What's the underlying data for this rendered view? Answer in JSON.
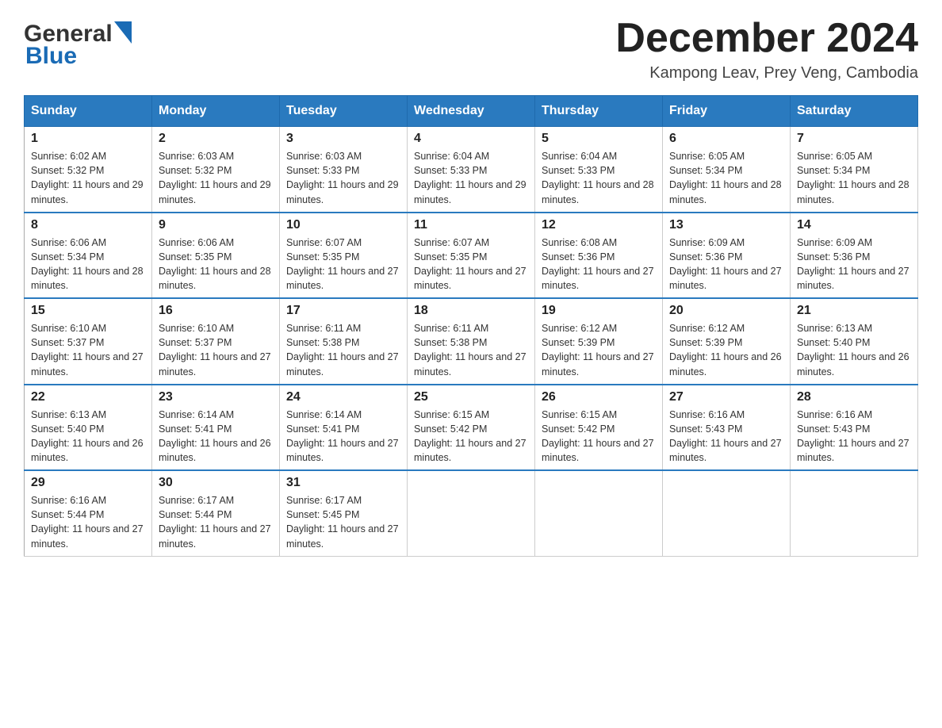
{
  "header": {
    "logo_general": "General",
    "logo_blue": "Blue",
    "month_title": "December 2024",
    "location": "Kampong Leav, Prey Veng, Cambodia"
  },
  "days_of_week": [
    "Sunday",
    "Monday",
    "Tuesday",
    "Wednesday",
    "Thursday",
    "Friday",
    "Saturday"
  ],
  "weeks": [
    [
      {
        "day": "1",
        "sunrise": "6:02 AM",
        "sunset": "5:32 PM",
        "daylight": "11 hours and 29 minutes."
      },
      {
        "day": "2",
        "sunrise": "6:03 AM",
        "sunset": "5:32 PM",
        "daylight": "11 hours and 29 minutes."
      },
      {
        "day": "3",
        "sunrise": "6:03 AM",
        "sunset": "5:33 PM",
        "daylight": "11 hours and 29 minutes."
      },
      {
        "day": "4",
        "sunrise": "6:04 AM",
        "sunset": "5:33 PM",
        "daylight": "11 hours and 29 minutes."
      },
      {
        "day": "5",
        "sunrise": "6:04 AM",
        "sunset": "5:33 PM",
        "daylight": "11 hours and 28 minutes."
      },
      {
        "day": "6",
        "sunrise": "6:05 AM",
        "sunset": "5:34 PM",
        "daylight": "11 hours and 28 minutes."
      },
      {
        "day": "7",
        "sunrise": "6:05 AM",
        "sunset": "5:34 PM",
        "daylight": "11 hours and 28 minutes."
      }
    ],
    [
      {
        "day": "8",
        "sunrise": "6:06 AM",
        "sunset": "5:34 PM",
        "daylight": "11 hours and 28 minutes."
      },
      {
        "day": "9",
        "sunrise": "6:06 AM",
        "sunset": "5:35 PM",
        "daylight": "11 hours and 28 minutes."
      },
      {
        "day": "10",
        "sunrise": "6:07 AM",
        "sunset": "5:35 PM",
        "daylight": "11 hours and 27 minutes."
      },
      {
        "day": "11",
        "sunrise": "6:07 AM",
        "sunset": "5:35 PM",
        "daylight": "11 hours and 27 minutes."
      },
      {
        "day": "12",
        "sunrise": "6:08 AM",
        "sunset": "5:36 PM",
        "daylight": "11 hours and 27 minutes."
      },
      {
        "day": "13",
        "sunrise": "6:09 AM",
        "sunset": "5:36 PM",
        "daylight": "11 hours and 27 minutes."
      },
      {
        "day": "14",
        "sunrise": "6:09 AM",
        "sunset": "5:36 PM",
        "daylight": "11 hours and 27 minutes."
      }
    ],
    [
      {
        "day": "15",
        "sunrise": "6:10 AM",
        "sunset": "5:37 PM",
        "daylight": "11 hours and 27 minutes."
      },
      {
        "day": "16",
        "sunrise": "6:10 AM",
        "sunset": "5:37 PM",
        "daylight": "11 hours and 27 minutes."
      },
      {
        "day": "17",
        "sunrise": "6:11 AM",
        "sunset": "5:38 PM",
        "daylight": "11 hours and 27 minutes."
      },
      {
        "day": "18",
        "sunrise": "6:11 AM",
        "sunset": "5:38 PM",
        "daylight": "11 hours and 27 minutes."
      },
      {
        "day": "19",
        "sunrise": "6:12 AM",
        "sunset": "5:39 PM",
        "daylight": "11 hours and 27 minutes."
      },
      {
        "day": "20",
        "sunrise": "6:12 AM",
        "sunset": "5:39 PM",
        "daylight": "11 hours and 26 minutes."
      },
      {
        "day": "21",
        "sunrise": "6:13 AM",
        "sunset": "5:40 PM",
        "daylight": "11 hours and 26 minutes."
      }
    ],
    [
      {
        "day": "22",
        "sunrise": "6:13 AM",
        "sunset": "5:40 PM",
        "daylight": "11 hours and 26 minutes."
      },
      {
        "day": "23",
        "sunrise": "6:14 AM",
        "sunset": "5:41 PM",
        "daylight": "11 hours and 26 minutes."
      },
      {
        "day": "24",
        "sunrise": "6:14 AM",
        "sunset": "5:41 PM",
        "daylight": "11 hours and 27 minutes."
      },
      {
        "day": "25",
        "sunrise": "6:15 AM",
        "sunset": "5:42 PM",
        "daylight": "11 hours and 27 minutes."
      },
      {
        "day": "26",
        "sunrise": "6:15 AM",
        "sunset": "5:42 PM",
        "daylight": "11 hours and 27 minutes."
      },
      {
        "day": "27",
        "sunrise": "6:16 AM",
        "sunset": "5:43 PM",
        "daylight": "11 hours and 27 minutes."
      },
      {
        "day": "28",
        "sunrise": "6:16 AM",
        "sunset": "5:43 PM",
        "daylight": "11 hours and 27 minutes."
      }
    ],
    [
      {
        "day": "29",
        "sunrise": "6:16 AM",
        "sunset": "5:44 PM",
        "daylight": "11 hours and 27 minutes."
      },
      {
        "day": "30",
        "sunrise": "6:17 AM",
        "sunset": "5:44 PM",
        "daylight": "11 hours and 27 minutes."
      },
      {
        "day": "31",
        "sunrise": "6:17 AM",
        "sunset": "5:45 PM",
        "daylight": "11 hours and 27 minutes."
      },
      null,
      null,
      null,
      null
    ]
  ],
  "labels": {
    "sunrise": "Sunrise:",
    "sunset": "Sunset:",
    "daylight": "Daylight:"
  }
}
